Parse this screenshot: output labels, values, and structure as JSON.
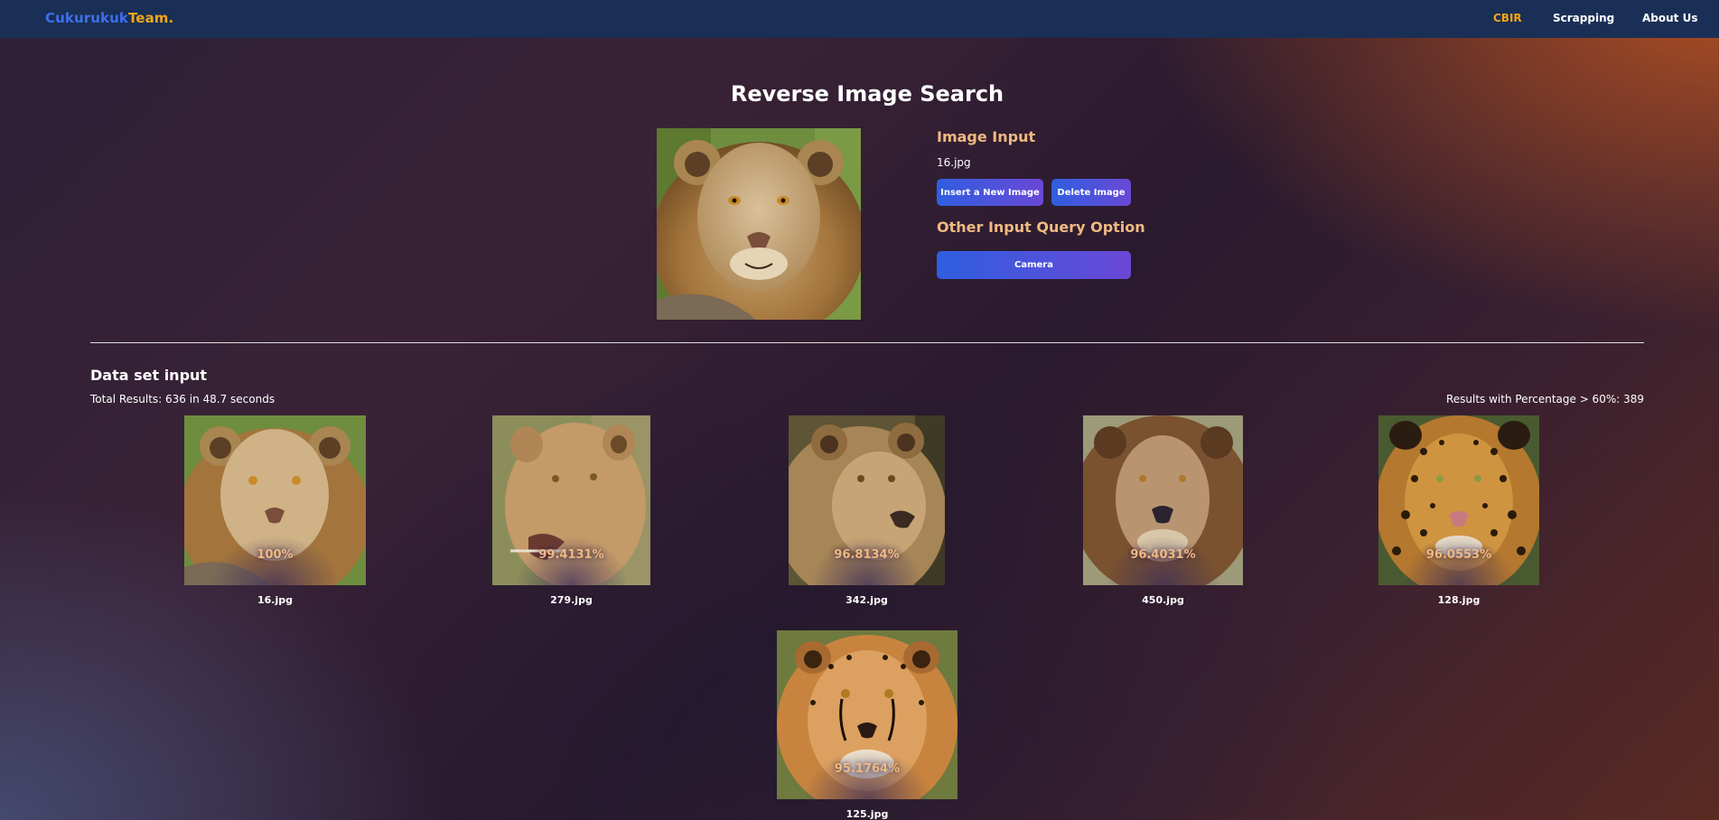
{
  "navbar": {
    "brand_part1": "Cukurukuk",
    "brand_part2": "Team.",
    "links": [
      "CBIR",
      "Scrapping",
      "About Us"
    ]
  },
  "page_title": "Reverse Image Search",
  "query": {
    "heading": "Image Input",
    "filename": "16.jpg",
    "insert_button": "Insert a New Image",
    "delete_button": "Delete Image",
    "other_heading": "Other Input Query Option",
    "camera_button": "Camera"
  },
  "dataset": {
    "heading": "Data set input",
    "total_results": "Total Results: 636 in 48.7 seconds",
    "percentage_results": "Results with Percentage > 60%: 389"
  },
  "results": [
    {
      "name": "16.jpg",
      "percent": "100%",
      "animal": "lion"
    },
    {
      "name": "279.jpg",
      "percent": "99.4131%",
      "animal": "lioness"
    },
    {
      "name": "342.jpg",
      "percent": "96.8134%",
      "animal": "lioness"
    },
    {
      "name": "450.jpg",
      "percent": "96.4031%",
      "animal": "lion"
    },
    {
      "name": "128.jpg",
      "percent": "96.0553%",
      "animal": "leopard"
    },
    {
      "name": "125.jpg",
      "percent": "95.1764%",
      "animal": "cheetah"
    }
  ],
  "colors": {
    "navbar": "#1a2f55",
    "accent": "#f3a51a",
    "brand_blue": "#3d6ff0",
    "heading_peach": "#f0b981"
  }
}
